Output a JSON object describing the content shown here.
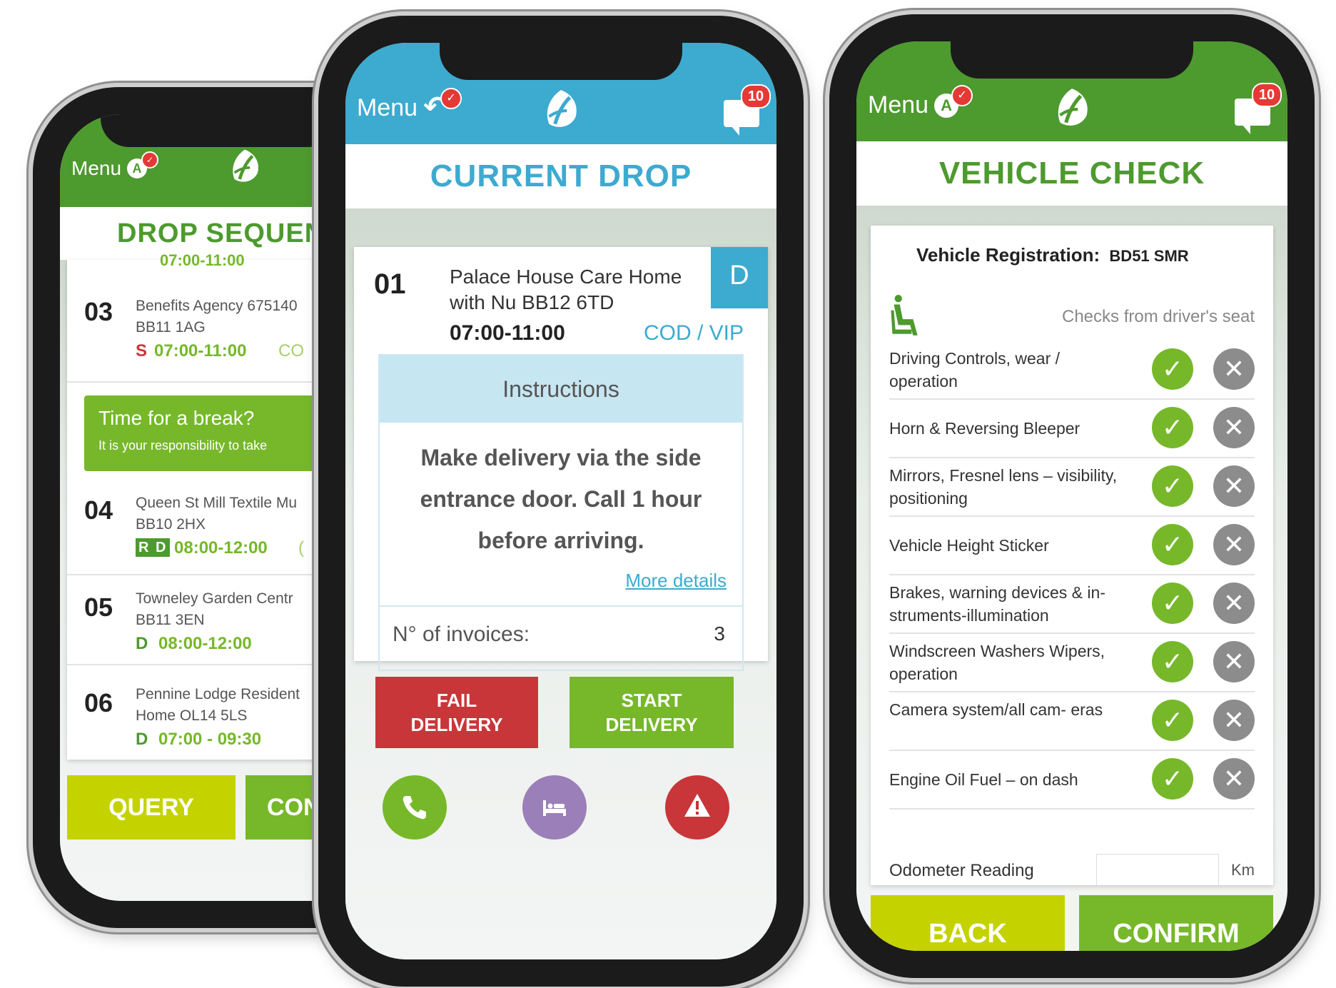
{
  "colors": {
    "green": "#4d9a2e",
    "lime": "#c4d200",
    "blue": "#3daad0",
    "red": "#c8363a",
    "purple": "#9b7fb8",
    "grey": "#8c8c8c"
  },
  "phone1": {
    "menu_label": "Menu",
    "title": "DROP SEQUEN",
    "partial_row": "07:00-11:00",
    "items": [
      {
        "num": "03",
        "addr1": "Benefits Agency 675140",
        "addr2": "BB11 1AG",
        "code": "S",
        "time": "07:00-11:00",
        "extra": "CO"
      },
      {
        "num": "04",
        "addr1": "Queen St Mill Textile Mu",
        "addr2": "BB10 2HX",
        "code": "R D",
        "time": "08:00-12:00",
        "extra": "("
      },
      {
        "num": "05",
        "addr1": "Towneley Garden Centr",
        "addr2": "BB11 3EN",
        "code": "D",
        "time": "08:00-12:00",
        "extra": ""
      },
      {
        "num": "06",
        "addr1": "Pennine Lodge Resident",
        "addr2": "Home OL14 5LS",
        "code": "D",
        "time": "07:00 - 09:30",
        "extra": ""
      }
    ],
    "break_title": "Time for a break?",
    "break_sub": "It is your responsibility to take",
    "query_label": "QUERY",
    "confirm_partial": "CON"
  },
  "phone2": {
    "menu_label": "Menu",
    "chat_count": "10",
    "title": "CURRENT DROP",
    "drop_num": "01",
    "drop_name1": "Palace House Care Home",
    "drop_name2": "with Nu BB12 6TD",
    "drop_time": "07:00-11:00",
    "drop_tag": "D",
    "drop_cod": "COD / VIP",
    "instructions_header": "Instructions",
    "instructions_text": "Make delivery via the side entrance door. Call 1 hour before arriving.",
    "more_details": "More details",
    "invoices_label": "N° of invoices:",
    "invoices_value": "3",
    "fail_label": "FAIL DELIVERY",
    "start_label": "START DELIVERY"
  },
  "phone3": {
    "menu_label": "Menu",
    "chat_count": "10",
    "title": "VEHICLE CHECK",
    "reg_label": "Vehicle Registration:",
    "reg_value": "BD51 SMR",
    "seat_label": "Checks from driver's seat",
    "checks": [
      {
        "label": "Driving Controls, wear / operation"
      },
      {
        "label": "Horn & Reversing Bleeper"
      },
      {
        "label": "Mirrors, Fresnel lens – visibility, positioning"
      },
      {
        "label": "Vehicle Height Sticker"
      },
      {
        "label": "Brakes, warning devices & in- struments-illumination"
      },
      {
        "label": "Windscreen Washers Wipers, operation"
      },
      {
        "label": "Camera system/all cam- eras"
      },
      {
        "label": "Engine Oil Fuel – on dash"
      }
    ],
    "odometer_label": "Odometer Reading",
    "odometer_unit": "Km",
    "back_label": "BACK",
    "confirm_label": "CONFIRM"
  }
}
